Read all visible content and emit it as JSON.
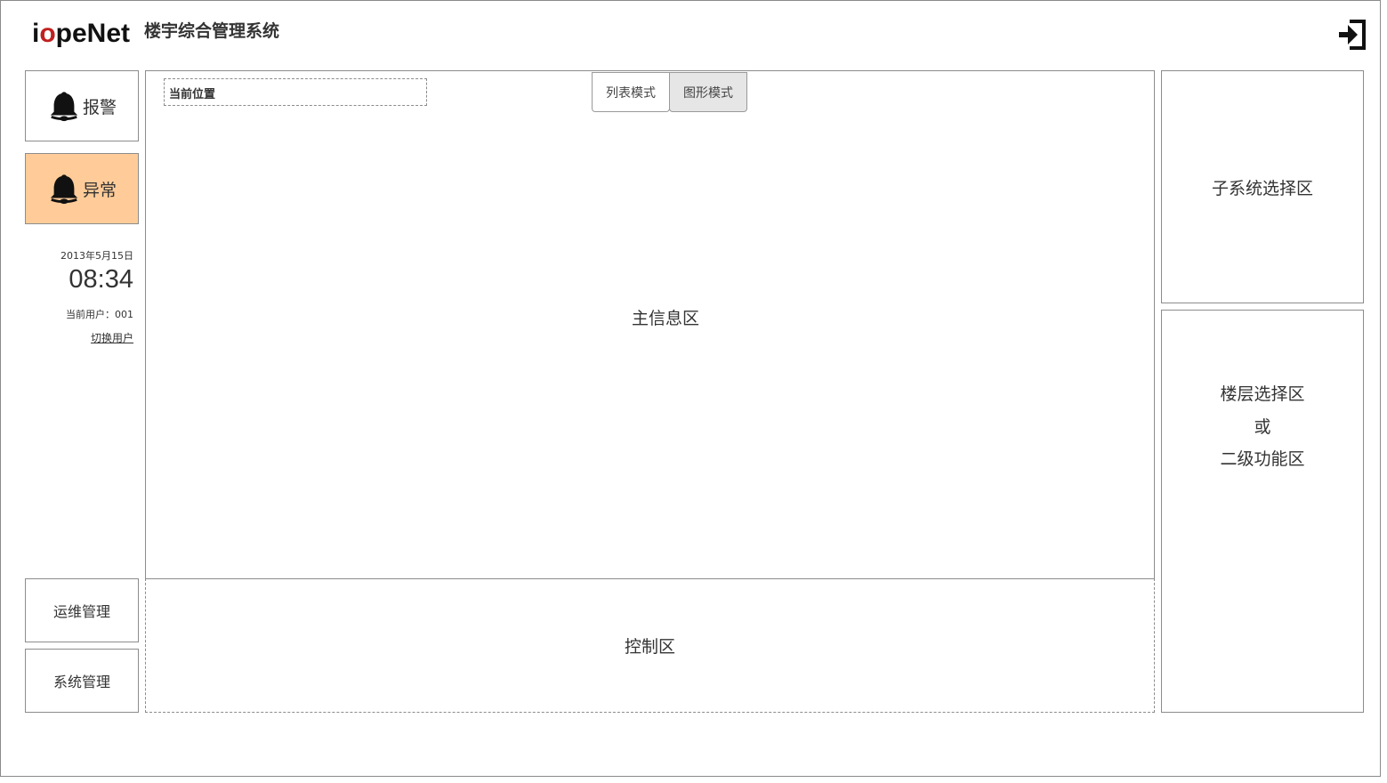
{
  "header": {
    "logo_prefix": "i",
    "logo_o": "o",
    "logo_rest": "peNet",
    "system_title": "楼宇综合管理系统",
    "logout_icon": "logout-icon"
  },
  "sidebar": {
    "alarm_label": "报警",
    "abnormal_label": "异常",
    "date": "2013年5月15日",
    "time": "08:34",
    "current_user": "当前用户：001",
    "switch_user": "切换用户",
    "ops_label": "运维管理",
    "sys_label": "系统管理"
  },
  "main": {
    "location_label": "当前位置",
    "mode_list": "列表模式",
    "mode_graph": "图形模式",
    "main_info_label": "主信息区",
    "control_label": "控制区"
  },
  "right": {
    "subsystem_label": "子系统选择区",
    "floor_line1": "楼层选择区",
    "floor_line2": "或",
    "floor_line3": "二级功能区"
  },
  "colors": {
    "abnormal_bg": "#ffcc99",
    "logo_accent": "#c0201f",
    "active_mode_bg": "#e6e6e6"
  }
}
